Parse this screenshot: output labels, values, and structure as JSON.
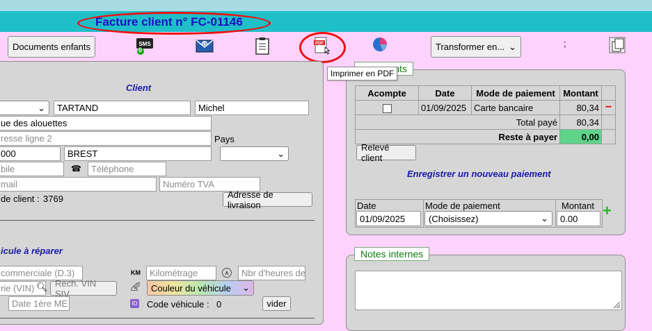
{
  "header": {
    "title": "Facture client n° FC-01146"
  },
  "toolbar": {
    "documents_enfants": "Documents enfants",
    "sms_icon": "sms-icon",
    "sms_badge": "0",
    "email_icon": "email-icon",
    "clipboard_icon": "clipboard-icon",
    "pdf_icon": "pdf-icon",
    "pie_icon": "pie-chart-icon",
    "transformer": "Transformer en...",
    "semicolon": ";",
    "copy_icon": "copy-icon",
    "tooltip": "Imprimer en PDF"
  },
  "client": {
    "heading": "Client",
    "civility": "",
    "nom": "TARTAND",
    "prenom": "Michel",
    "adresse1": "ue des alouettes",
    "adresse2_placeholder": "resse ligne 2",
    "pays_label": "Pays",
    "pays": "",
    "code_postal": "000",
    "ville": "BREST",
    "mobile_placeholder": "bile",
    "telephone_placeholder": "Téléphone",
    "email_placeholder": "mail",
    "tva_placeholder": "Numéro TVA",
    "code_client_label": "de client :",
    "code_client": "3769",
    "livraison_button": "Adresse de livraison"
  },
  "vehicule": {
    "heading": "icule à réparer",
    "commerciale_placeholder": "commerciale (D.3)",
    "km_label": "KM",
    "kilometrage_placeholder": "Kilométrage",
    "heures_placeholder": "Nbr d'heures de",
    "vin_placeholder": "rie (VIN)",
    "rech_vin_button": "Rech. VIN SIV",
    "couleur": "Couleur du véhicule",
    "date_placeholder": "Date 1ère ME",
    "code_vehicule_label": "Code véhicule :",
    "code_vehicule": "0",
    "vider_button": "vider"
  },
  "paiements": {
    "legend": "nts",
    "columns": [
      "Acompte",
      "Date",
      "Mode de paiement",
      "Montant"
    ],
    "rows": [
      {
        "acompte": false,
        "date": "01/09/2025",
        "mode": "Carte bancaire",
        "montant": "80,34"
      }
    ],
    "total_paye_label": "Total payé",
    "total_paye": "80,34",
    "reste_label": "Reste à payer",
    "reste": "0,00",
    "releve_button": "Relevé client",
    "nouveau_heading": "Enregistrer un nouveau paiement",
    "new_date_label": "Date",
    "new_mode_label": "Mode de paiement",
    "new_montant_label": "Montant",
    "new_date": "01/09/2025",
    "new_mode": "(Choisissez)",
    "new_montant": "0.00",
    "colors": {
      "reste_bg": "#5fd38a",
      "add": "#22bb22",
      "remove": "#dd0000"
    }
  },
  "notes": {
    "legend": "Notes internes"
  },
  "colors": {
    "page_bg": "#fdd3fd",
    "title_bar": "#1fbfc8",
    "title_text": "#1a0fbf",
    "highlight_ellipse": "#ee1111"
  }
}
